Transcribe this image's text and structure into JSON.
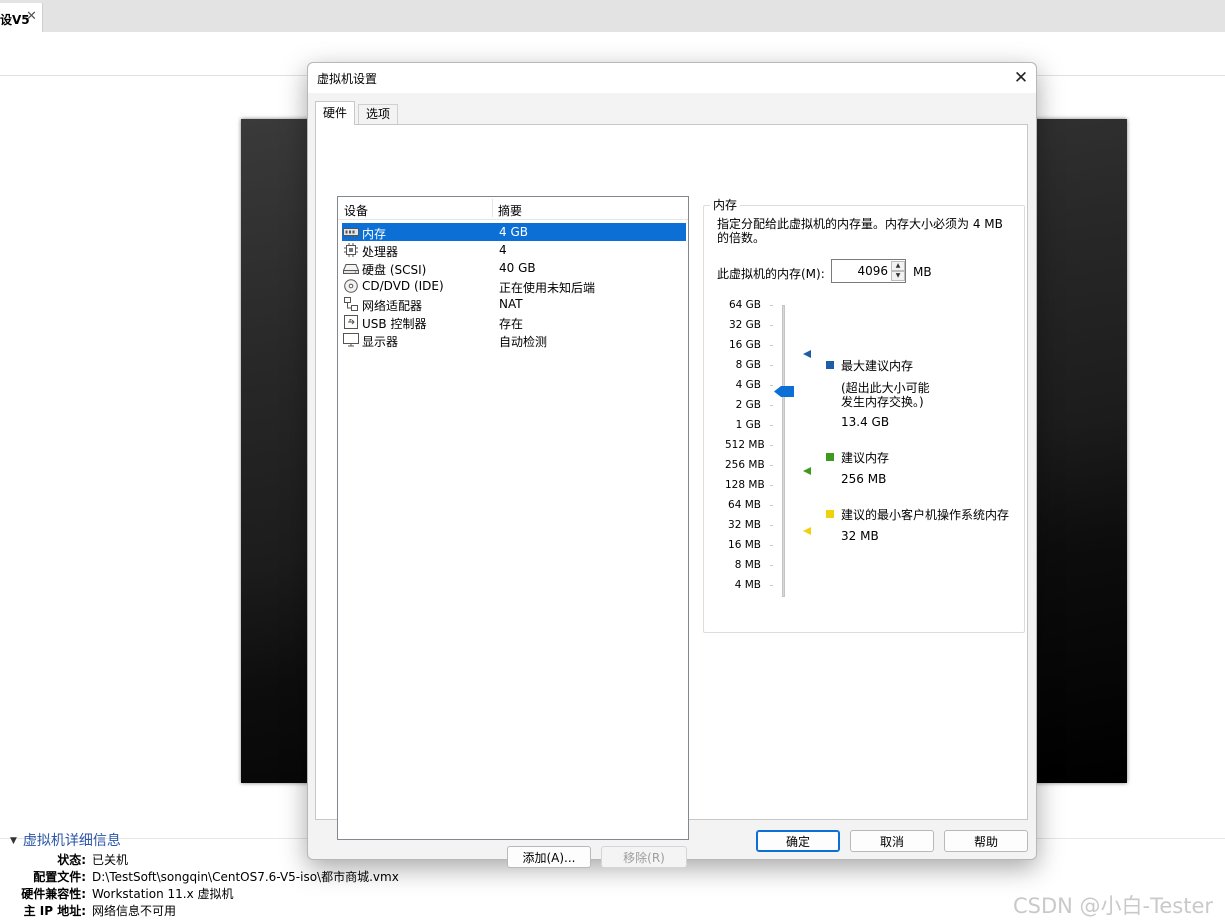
{
  "app": {
    "tab_title": "设V5",
    "tab_close": "✕"
  },
  "details": {
    "title": "虚拟机详细信息",
    "rows": [
      {
        "key": "状态:",
        "value": "已关机"
      },
      {
        "key": "配置文件:",
        "value": "D:\\TestSoft\\songqin\\CentOS7.6-V5-iso\\都市商城.vmx"
      },
      {
        "key": "硬件兼容性:",
        "value": "Workstation 11.x 虚拟机"
      },
      {
        "key": "主 IP 地址:",
        "value": "网络信息不可用"
      }
    ]
  },
  "watermark": "CSDN @小白-Tester",
  "dialog": {
    "title": "虚拟机设置",
    "close": "✕",
    "tabs": [
      "硬件",
      "选项"
    ],
    "device_list": {
      "headers": [
        "设备",
        "摘要"
      ],
      "rows": [
        {
          "name": "内存",
          "summary": "4 GB",
          "icon": "memory-icon",
          "selected": true
        },
        {
          "name": "处理器",
          "summary": "4",
          "icon": "cpu-icon",
          "selected": false
        },
        {
          "name": "硬盘 (SCSI)",
          "summary": "40 GB",
          "icon": "harddisk-icon",
          "selected": false
        },
        {
          "name": "CD/DVD (IDE)",
          "summary": "正在使用未知后端",
          "icon": "cd-dvd-icon",
          "selected": false
        },
        {
          "name": "网络适配器",
          "summary": "NAT",
          "icon": "network-adapter-icon",
          "selected": false
        },
        {
          "name": "USB 控制器",
          "summary": "存在",
          "icon": "usb-icon",
          "selected": false
        },
        {
          "name": "显示器",
          "summary": "自动检测",
          "icon": "display-icon",
          "selected": false
        }
      ]
    },
    "add_button": "添加(A)...",
    "remove_button": "移除(R)",
    "memory": {
      "group_title": "内存",
      "description": "指定分配给此虚拟机的内存量。内存大小必须为 4 MB 的倍数。",
      "label": "此虚拟机的内存(M):",
      "value": "4096",
      "unit": "MB",
      "scale": [
        "64 GB",
        "32 GB",
        "16 GB",
        "8 GB",
        "4 GB",
        "2 GB",
        "1 GB",
        "512 MB",
        "256 MB",
        "128 MB",
        "64 MB",
        "32 MB",
        "16 MB",
        "8 MB",
        "4 MB"
      ],
      "current_level": "4 GB",
      "legend": {
        "max": {
          "title": "最大建议内存",
          "note": "(超出此大小可能\n发生内存交换。)",
          "value": "13.4 GB",
          "color": "#1c5fa6"
        },
        "recommended": {
          "title": "建议内存",
          "value": "256 MB",
          "color": "#3d9a1c"
        },
        "min_guest": {
          "title": "建议的最小客户机操作系统内存",
          "value": "32 MB",
          "color": "#f2d10a"
        }
      }
    },
    "buttons": {
      "ok": "确定",
      "cancel": "取消",
      "help": "帮助"
    }
  }
}
